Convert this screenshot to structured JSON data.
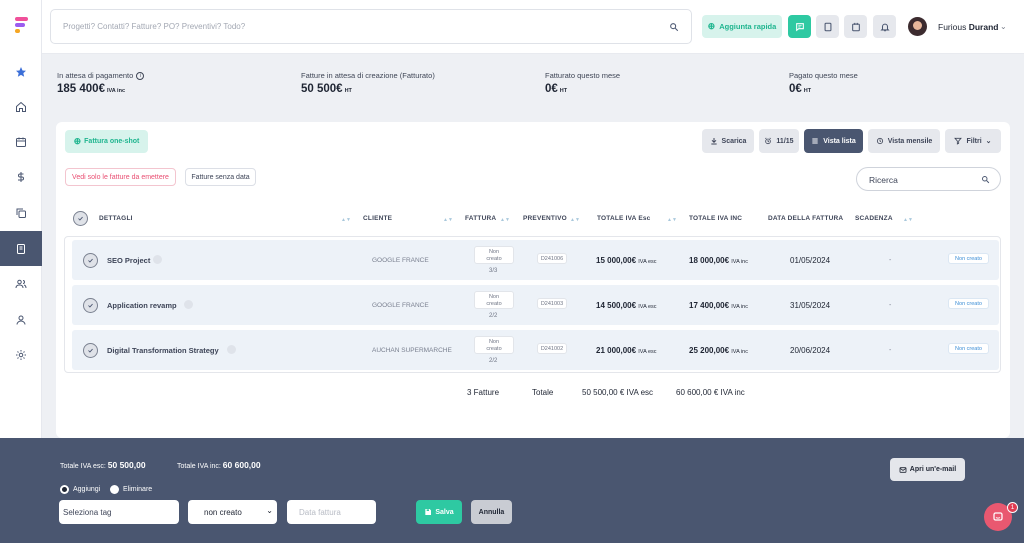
{
  "colors": {
    "accent_green": "#2ec9a2",
    "sidebar_active": "#4a5670",
    "bottom_bar": "#4a5670",
    "pink_filter": "#e94f73",
    "status_blue": "#3c8ed6"
  },
  "sidebar": {
    "items": [
      {
        "icon": "star-icon"
      },
      {
        "icon": "home-icon"
      },
      {
        "icon": "calendar-icon"
      },
      {
        "icon": "dollar-icon"
      },
      {
        "icon": "copy-icon"
      },
      {
        "icon": "invoice-icon",
        "active": true
      },
      {
        "icon": "users-icon"
      },
      {
        "icon": "user-icon"
      },
      {
        "icon": "settings-icon"
      }
    ]
  },
  "topbar": {
    "search_placeholder": "Progetti? Contatti? Fatture? PO? Preventivi? Todo?",
    "quick_add_label": "Aggiunta rapida",
    "user_first": "Furious",
    "user_last": "Durand"
  },
  "stats": [
    {
      "label": "In attesa di pagamento",
      "value": "185 400€",
      "suffix": "IVA inc",
      "info": true
    },
    {
      "label": "Fatture in attesa di creazione (Fatturato)",
      "value": "50 500€",
      "suffix": "HT"
    },
    {
      "label": "Fatturato questo mese",
      "value": "0€",
      "suffix": "HT"
    },
    {
      "label": "Pagato questo mese",
      "value": "0€",
      "suffix": "HT"
    }
  ],
  "toolbar": {
    "oneshot_label": "Fattura one-shot",
    "download_label": "Scarica",
    "period_label": "11/15",
    "list_view_label": "Vista lista",
    "month_view_label": "Vista mensile",
    "filters_label": "Filtri",
    "filter_pink": "Vedi solo le fatture da emettere",
    "filter_gray": "Fatture senza data",
    "search_placeholder": "Ricerca"
  },
  "table": {
    "headers": [
      "DETTAGLI",
      "CLIENTE",
      "FATTURA",
      "PREVENTIVO",
      "TOTALE IVA Esc",
      "TOTALE IVA INC",
      "DATA DELLA FATTURA",
      "SCADENZA"
    ],
    "rows": [
      {
        "name": "SEO Project",
        "client": "GOOGLE FRANCE",
        "invoice_line1": "Non",
        "invoice_line2": "creato",
        "count": "3/3",
        "quote": "D241006",
        "total_esc": "15 000,00€",
        "total_inc": "18 000,00€",
        "date": "01/05/2024",
        "due": "-",
        "status": "Non creato"
      },
      {
        "name": "Application revamp",
        "client": "GOOGLE FRANCE",
        "invoice_line1": "Non",
        "invoice_line2": "creato",
        "count": "2/2",
        "quote": "D241003",
        "total_esc": "14 500,00€",
        "total_inc": "17 400,00€",
        "date": "31/05/2024",
        "due": "-",
        "status": "Non creato"
      },
      {
        "name": "Digital Transformation Strategy",
        "client": "AUCHAN SUPERMARCHE",
        "invoice_line1": "Non",
        "invoice_line2": "creato",
        "count": "2/2",
        "quote": "D241002",
        "total_esc": "21 000,00€",
        "total_inc": "25 200,00€",
        "date": "20/06/2024",
        "due": "-",
        "status": "Non creato"
      }
    ],
    "esc_suffix": "IVA esc",
    "inc_suffix": "IVA inc",
    "totals": {
      "count": "3 Fatture",
      "label": "Totale",
      "esc": "50 500,00 € IVA esc",
      "inc": "60 600,00 € IVA inc"
    }
  },
  "bottombar": {
    "total_esc_label": "Totale IVA esc:",
    "total_esc_value": "50 500,00",
    "total_inc_label": "Totale IVA inc:",
    "total_inc_value": "60 600,00",
    "radio_add": "Aggiungi",
    "radio_remove": "Eliminare",
    "tag_placeholder": "Seleziona tag",
    "status_select": "non creato",
    "date_placeholder": "Data fattura",
    "save_label": "Salva",
    "cancel_label": "Annulla",
    "email_label": "Apri un'e-mail",
    "chat_badge": "1"
  }
}
